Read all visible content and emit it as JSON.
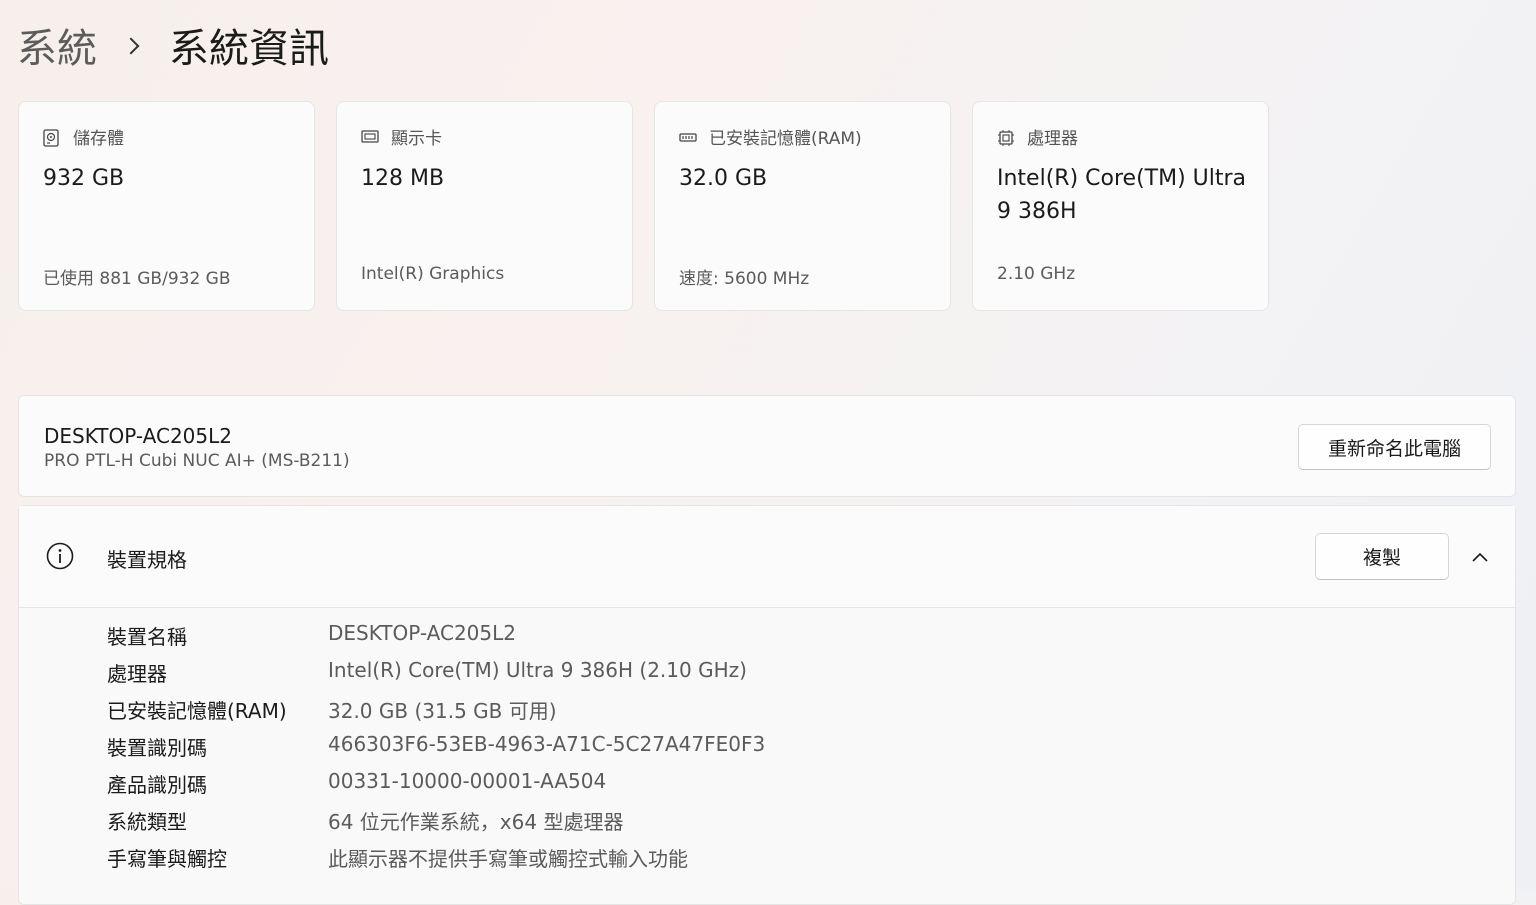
{
  "breadcrumb": {
    "parent": "系統",
    "current": "系統資訊"
  },
  "cards": [
    {
      "title": "儲存體",
      "icon": "storage-drive-icon",
      "value": "932 GB",
      "sub": "已使用 881 GB/932 GB"
    },
    {
      "title": "顯示卡",
      "icon": "graphics-card-icon",
      "value": "128 MB",
      "sub": "Intel(R) Graphics"
    },
    {
      "title": "已安裝記憶體(RAM)",
      "icon": "memory-ram-icon",
      "value": "32.0 GB",
      "sub": "速度: 5600 MHz"
    },
    {
      "title": "處理器",
      "icon": "processor-chip-icon",
      "value": "Intel(R) Core(TM) Ultra 9 386H",
      "sub": "2.10 GHz"
    }
  ],
  "device": {
    "name": "DESKTOP-AC205L2",
    "model": "PRO PTL-H Cubi NUC AI+ (MS-B211)",
    "rename_label": "重新命名此電腦"
  },
  "specs": {
    "title": "裝置規格",
    "copy_label": "複製",
    "rows": [
      {
        "label": "裝置名稱",
        "value": "DESKTOP-AC205L2"
      },
      {
        "label": "處理器",
        "value": "Intel(R) Core(TM) Ultra 9 386H (2.10 GHz)"
      },
      {
        "label": "已安裝記憶體(RAM)",
        "value": "32.0 GB (31.5 GB 可用)"
      },
      {
        "label": "裝置識別碼",
        "value": "466303F6-53EB-4963-A71C-5C27A47FE0F3"
      },
      {
        "label": "產品識別碼",
        "value": "00331-10000-00001-AA504"
      },
      {
        "label": "系統類型",
        "value": "64 位元作業系統，x64 型處理器"
      },
      {
        "label": "手寫筆與觸控",
        "value": "此顯示器不提供手寫筆或觸控式輸入功能"
      }
    ]
  }
}
